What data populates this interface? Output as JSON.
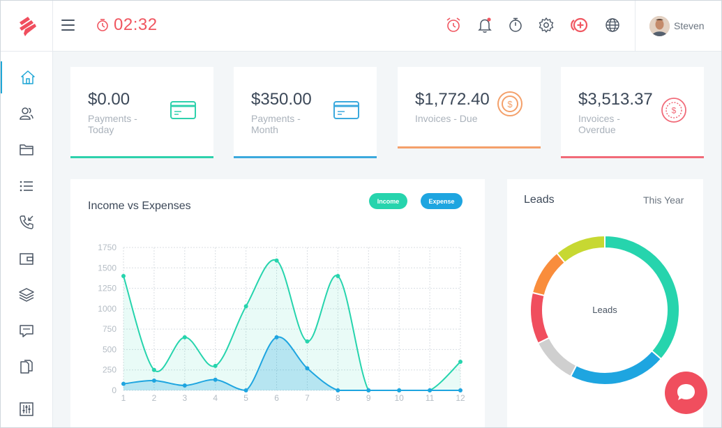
{
  "header": {
    "timer": "02:32",
    "user_name": "Steven",
    "icons": [
      "alarm-clock-icon",
      "bell-icon",
      "stopwatch-icon",
      "gear-icon",
      "add-circle-icon",
      "globe-icon"
    ]
  },
  "sidebar": {
    "items": [
      "home-icon",
      "users-icon",
      "folder-icon",
      "list-icon",
      "phone-incoming-icon",
      "wallet-icon",
      "layers-icon",
      "chat-icon",
      "documents-icon",
      "sliders-icon"
    ]
  },
  "stats": [
    {
      "value": "$0.00",
      "label": "Payments - Today",
      "color": "#2ed1ac"
    },
    {
      "value": "$350.00",
      "label": "Payments - Month",
      "color": "#3ba9dd"
    },
    {
      "value": "$1,772.40",
      "label": "Invoices - Due",
      "color": "#f4a06a"
    },
    {
      "value": "$3,513.37",
      "label": "Invoices - Overdue",
      "color": "#f16a78"
    }
  ],
  "colors": {
    "income": "#26d4ad",
    "expense": "#1ea5e0",
    "accent_red": "#f05660"
  },
  "chart_data": [
    {
      "type": "area",
      "title": "Income vs Expenses",
      "x": [
        1,
        2,
        3,
        4,
        5,
        6,
        7,
        8,
        9,
        10,
        11,
        12
      ],
      "ylim": [
        0,
        1750
      ],
      "yticks": [
        0,
        250,
        500,
        750,
        1000,
        1250,
        1500,
        1750
      ],
      "grid": true,
      "legend": "top-right",
      "series": [
        {
          "name": "Income",
          "values": [
            1400,
            250,
            650,
            300,
            1030,
            1590,
            600,
            1400,
            0,
            0,
            0,
            350
          ]
        },
        {
          "name": "Expense",
          "values": [
            80,
            120,
            60,
            130,
            0,
            650,
            270,
            0,
            0,
            0,
            0,
            0
          ]
        }
      ]
    },
    {
      "type": "pie",
      "title": "Leads",
      "filter": "This Year",
      "center_label": "Leads",
      "slices": [
        {
          "value": 36,
          "color": "#26d4ad"
        },
        {
          "value": 21,
          "color": "#1ea5e0"
        },
        {
          "value": 10,
          "color": "#cfcfcf"
        },
        {
          "value": 11,
          "color": "#f04e5e"
        },
        {
          "value": 10,
          "color": "#f98d3c"
        },
        {
          "value": 11,
          "color": "#c7d832"
        }
      ]
    }
  ]
}
